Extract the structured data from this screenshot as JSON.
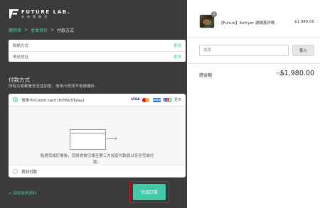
{
  "brand": {
    "name_en": "FUTURE LAB.",
    "name_zh": "未 來 實 驗 室"
  },
  "breadcrumb": {
    "items": [
      "購物車",
      "會員資料",
      "付款方式"
    ],
    "separator": ">"
  },
  "shipping_info": {
    "rows": [
      {
        "label": "聯絡方式",
        "action": "更改"
      },
      {
        "label": "寄送地址",
        "action": "更改"
      }
    ]
  },
  "payment": {
    "title": "付款方式",
    "subtitle": "所有交易都是安全並加密。信用卡資訊不會被儲存",
    "options": [
      {
        "label": "信用卡/Credit card (HiTRUSTpay)",
        "selected": true
      },
      {
        "label": "貨到付款",
        "selected": false
      }
    ],
    "card_brands": [
      "visa-logo",
      "mastercard-logo",
      "amex-logo",
      "jcb-logo"
    ],
    "visa_text": "VISA",
    "amex_text": "AMEX",
    "jcb_letters": [
      "J",
      "C",
      "B"
    ],
    "more_label": "更多",
    "redirect_note": "點選完成訂單後，您將會被引導至第三方加密付款頁以安全完成付款。"
  },
  "nav": {
    "back_label": "< 回到會員資料",
    "complete_label": "完成訂單"
  },
  "order_summary": {
    "item": {
      "name": "【Future】Airfryer 濾鍋蒸炸鍋",
      "price": "$1,980.00",
      "quantity": "1"
    },
    "discount": {
      "placeholder": "優惠",
      "value": "",
      "apply_label": "套入"
    },
    "total_label": "總金額",
    "currency": "TWD",
    "total_amount": "$1,980.00"
  },
  "colors": {
    "accent": "#43c8a8",
    "left_panel_bg": "#3b3b3b",
    "highlight_border": "#e0141b"
  }
}
